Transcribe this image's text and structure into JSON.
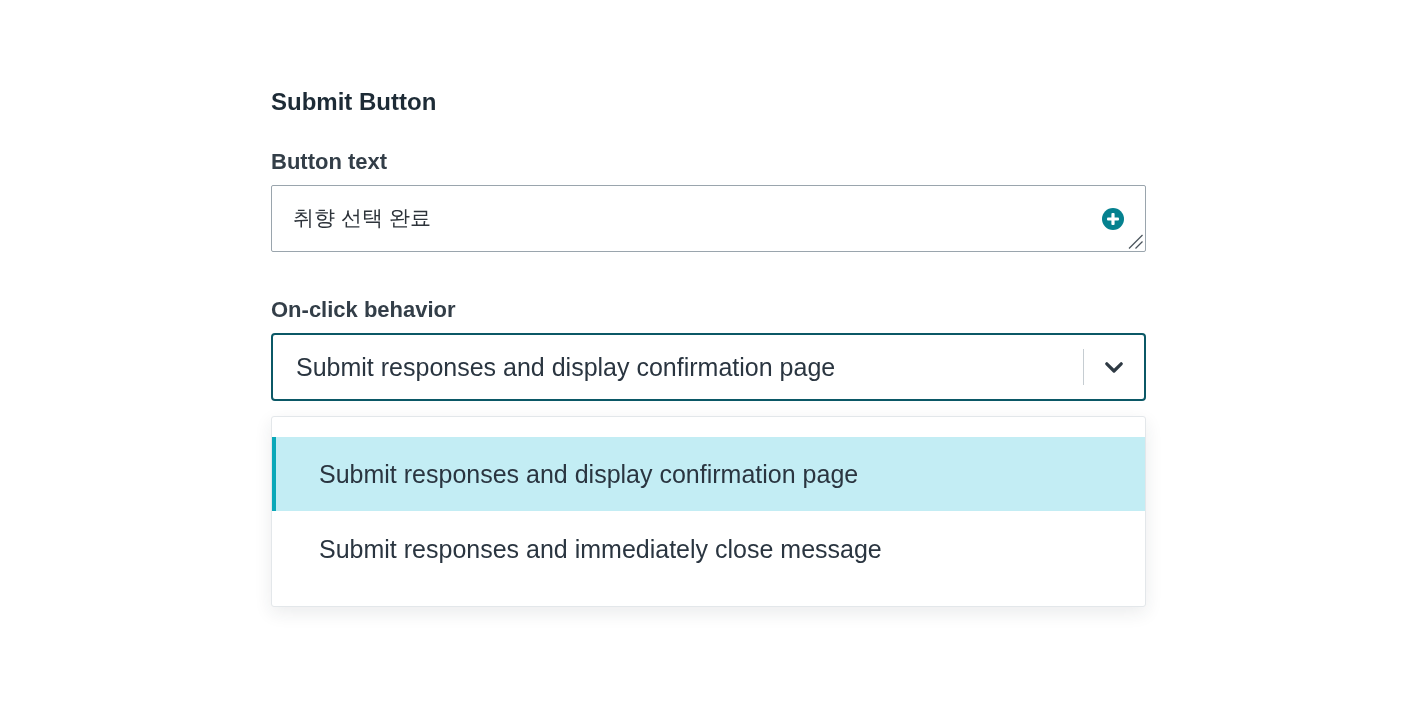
{
  "section": {
    "title": "Submit Button"
  },
  "button_text": {
    "label": "Button text",
    "value": "취향 선택 완료"
  },
  "on_click": {
    "label": "On-click behavior",
    "value": "Submit responses and display confirmation page",
    "expanded": true,
    "options": [
      {
        "label": "Submit responses and display confirmation page",
        "selected": true
      },
      {
        "label": "Submit responses and immediately close message",
        "selected": false
      }
    ]
  }
}
